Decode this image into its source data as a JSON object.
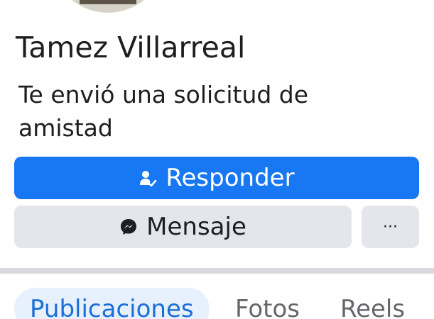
{
  "profile": {
    "name": "Tamez Villarreal",
    "status_text": "Te envió una solicitud de amistad"
  },
  "actions": {
    "respond_label": "Responder",
    "respond_icon": "friend-request-icon",
    "message_label": "Mensaje",
    "message_icon": "messenger-icon",
    "more_label": "···"
  },
  "tabs": [
    {
      "label": "Publicaciones",
      "active": true
    },
    {
      "label": "Fotos",
      "active": false
    },
    {
      "label": "Reels",
      "active": false
    }
  ],
  "colors": {
    "accent": "#1877f2",
    "secondary_button": "#e4e6eb",
    "active_tab_bg": "#e7f0fd",
    "active_tab_text": "#1b6fd9"
  }
}
